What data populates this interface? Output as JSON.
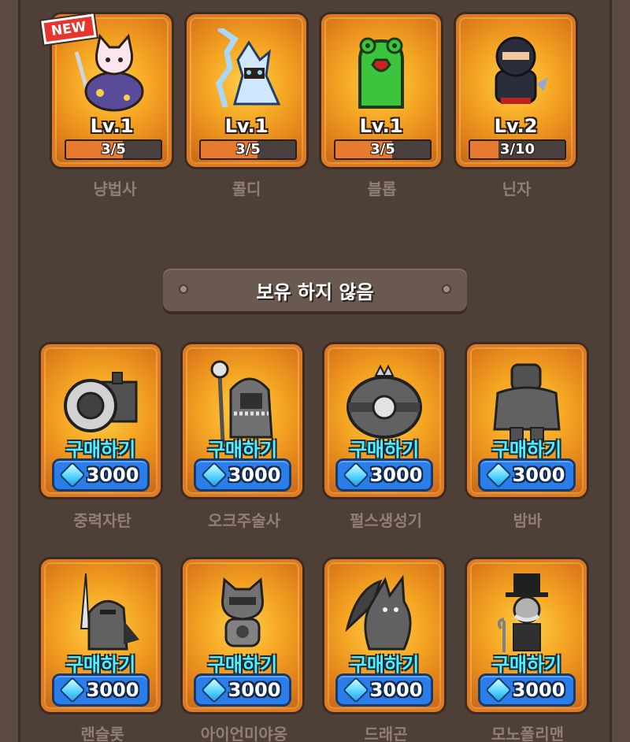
{
  "owned": [
    {
      "name": "냥법사",
      "level": "Lv.1",
      "progress_text": "3/5",
      "progress": 0.6,
      "new_badge": "NEW",
      "icon": "cat-wizard-icon"
    },
    {
      "name": "콜디",
      "level": "Lv.1",
      "progress_text": "3/5",
      "progress": 0.6,
      "icon": "ice-mage-icon"
    },
    {
      "name": "블롭",
      "level": "Lv.1",
      "progress_text": "3/5",
      "progress": 0.6,
      "icon": "slime-icon"
    },
    {
      "name": "닌자",
      "level": "Lv.2",
      "progress_text": "3/10",
      "progress": 0.3,
      "icon": "ninja-icon"
    }
  ],
  "section_title": "보유 하지 않음",
  "unowned": [
    {
      "name": "중력자탄",
      "buy_label": "구매하기",
      "price": "3000",
      "icon": "cannon-icon"
    },
    {
      "name": "오크주술사",
      "buy_label": "구매하기",
      "price": "3000",
      "icon": "orc-shaman-icon"
    },
    {
      "name": "펄스생성기",
      "buy_label": "구매하기",
      "price": "3000",
      "icon": "pulse-generator-icon"
    },
    {
      "name": "밤바",
      "buy_label": "구매하기",
      "price": "3000",
      "icon": "golem-icon"
    },
    {
      "name": "랜슬롯",
      "buy_label": "구매하기",
      "price": "3000",
      "icon": "knight-icon"
    },
    {
      "name": "아이언미야옹",
      "buy_label": "구매하기",
      "price": "3000",
      "icon": "iron-cat-icon"
    },
    {
      "name": "드래곤",
      "buy_label": "구매하기",
      "price": "3000",
      "icon": "dragon-icon"
    },
    {
      "name": "모노폴리맨",
      "buy_label": "구매하기",
      "price": "3000",
      "icon": "tophat-man-icon"
    }
  ],
  "colors": {
    "card_orange": "#f5a623",
    "buy_text": "#4ff0ff",
    "price_button": "#2b7de9",
    "badge_red": "#e7352f"
  }
}
